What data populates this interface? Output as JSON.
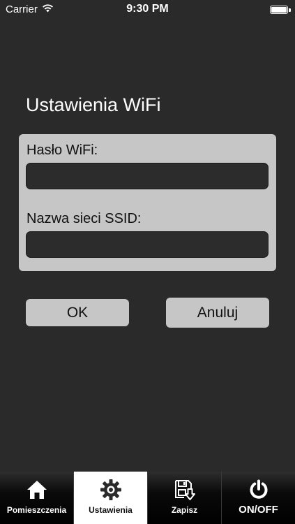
{
  "status_bar": {
    "carrier": "Carrier",
    "time": "9:30 PM",
    "battery_level": 1.0
  },
  "page": {
    "title": "Ustawienia WiFi"
  },
  "form": {
    "password_label": "Hasło WiFi:",
    "password_value": "",
    "ssid_label": "Nazwa sieci SSID:",
    "ssid_value": ""
  },
  "buttons": {
    "ok_label": "OK",
    "cancel_label": "Anuluj"
  },
  "tab_bar": {
    "active_tab": "Ustawienia",
    "tabs": [
      {
        "label": "Pomieszczenia",
        "icon": "home-icon"
      },
      {
        "label": "Ustawienia",
        "icon": "gear-icon"
      },
      {
        "label": "Zapisz",
        "icon": "save-icon"
      },
      {
        "label": "ON/OFF",
        "icon": "power-icon"
      }
    ]
  },
  "colors": {
    "background": "#2a2a2a",
    "panel": "#c6c6c6",
    "input": "#2c2c2c",
    "tab_bar": "#000000",
    "tab_active": "#ffffff"
  }
}
